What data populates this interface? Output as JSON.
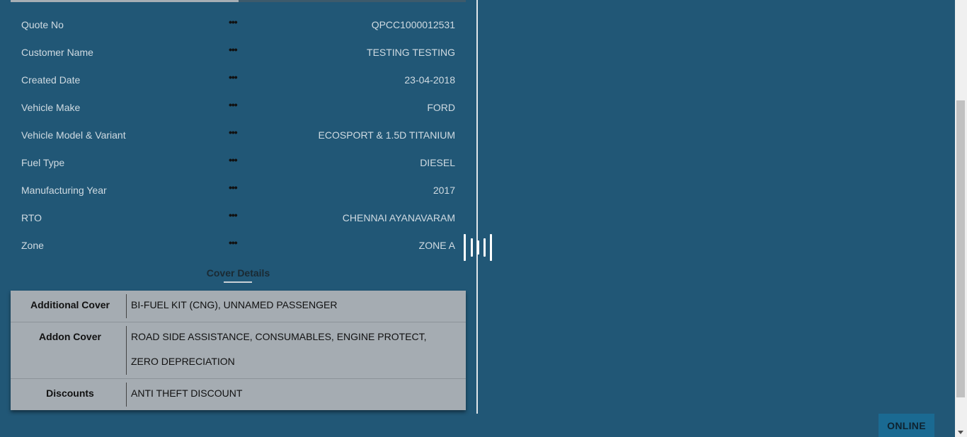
{
  "quote_progress": 0.5,
  "details": [
    {
      "label": "Quote No",
      "sep": "•••",
      "value": "QPCC1000012531"
    },
    {
      "label": "Customer Name",
      "sep": "•••",
      "value": "TESTING TESTING"
    },
    {
      "label": "Created Date",
      "sep": "•••",
      "value": "23-04-2018"
    },
    {
      "label": "Vehicle Make",
      "sep": "•••",
      "value": "FORD"
    },
    {
      "label": "Vehicle Model & Variant",
      "sep": "•••",
      "value": "ECOSPORT & 1.5D TITANIUM"
    },
    {
      "label": "Fuel Type",
      "sep": "•••",
      "value": "DIESEL"
    },
    {
      "label": "Manufacturing Year",
      "sep": "•••",
      "value": "2017"
    },
    {
      "label": "RTO",
      "sep": "•••",
      "value": "CHENNAI AYANAVARAM"
    },
    {
      "label": "Zone",
      "sep": "•••",
      "value": "ZONE A"
    }
  ],
  "cover": {
    "title": "Cover Details",
    "additional_label": "Additional Cover",
    "additional_value": "BI-FUEL KIT (CNG), UNNAMED PASSENGER",
    "addon_label": "Addon Cover",
    "addon_line1": "ROAD SIDE ASSISTANCE, CONSUMABLES, ENGINE PROTECT,",
    "addon_line2": "ZERO DEPRECIATION",
    "discounts_label": "Discounts",
    "discounts_value": "ANTI THEFT DISCOUNT"
  },
  "online_button": "ONLINE",
  "colors": {
    "background": "#215776",
    "table": "#a5acb2",
    "button": "#1a6a92"
  }
}
